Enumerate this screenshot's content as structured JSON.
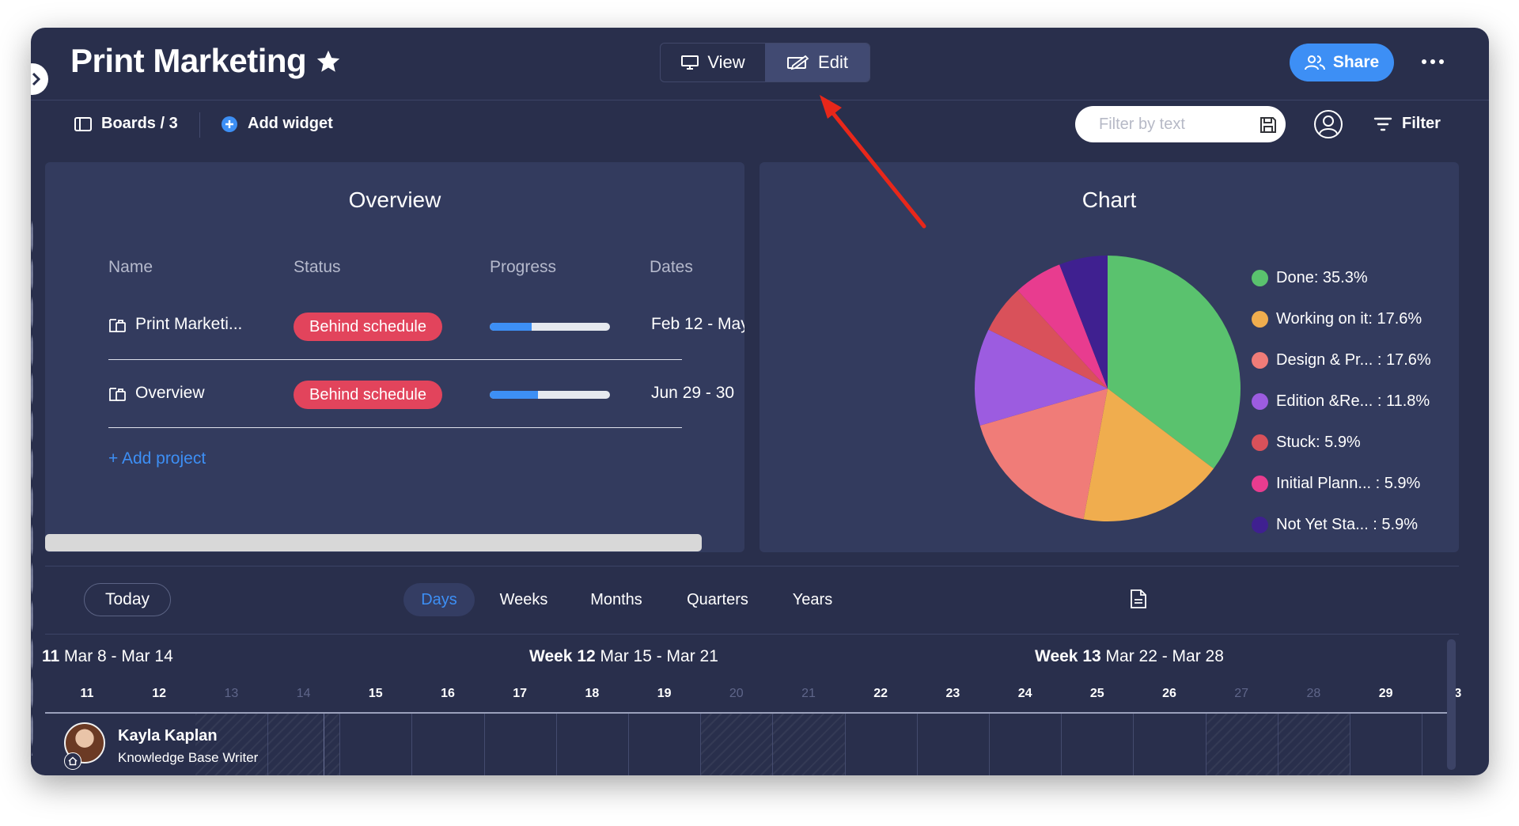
{
  "header": {
    "title": "Print Marketing",
    "view_label": "View",
    "edit_label": "Edit",
    "share_label": "Share"
  },
  "toolbar": {
    "boards_label": "Boards / 3",
    "add_widget_label": "Add widget",
    "filter_placeholder": "Filter by text",
    "filter_label": "Filter"
  },
  "overview": {
    "title": "Overview",
    "columns": [
      "Name",
      "Status",
      "Progress",
      "Dates"
    ],
    "rows": [
      {
        "name": "Print Marketi...",
        "status": "Behind schedule",
        "progress": 0.35,
        "dates": "Feb 12 - May"
      },
      {
        "name": "Overview",
        "status": "Behind schedule",
        "progress": 0.4,
        "dates": "Jun 29 - 30"
      }
    ],
    "add_project_label": "+ Add project"
  },
  "chart": {
    "title": "Chart"
  },
  "chart_data": {
    "type": "pie",
    "title": "Chart",
    "legend_position": "right",
    "slices": [
      {
        "label": "Done: 35.3%",
        "value": 35.3,
        "color": "#5ac26e"
      },
      {
        "label": "Working on it: 17.6%",
        "value": 17.6,
        "color": "#f0ad4e"
      },
      {
        "label": "Design & Pr... : 17.6%",
        "value": 17.6,
        "color": "#f07c78"
      },
      {
        "label": "Edition &Re... : 11.8%",
        "value": 11.8,
        "color": "#9c5ce0"
      },
      {
        "label": "Stuck: 5.9%",
        "value": 5.9,
        "color": "#d9515a"
      },
      {
        "label": "Initial Plann... : 5.9%",
        "value": 5.9,
        "color": "#e83c8f"
      },
      {
        "label": "Not Yet Sta... : 5.9%",
        "value": 5.9,
        "color": "#3f2090"
      }
    ]
  },
  "timeline": {
    "today_label": "Today",
    "scales": [
      "Days",
      "Weeks",
      "Months",
      "Quarters",
      "Years"
    ],
    "active_scale": "Days",
    "weeks": [
      {
        "prefix": "11",
        "range": "Mar 8 - Mar 14"
      },
      {
        "prefix": "Week 12",
        "range": "Mar 15 - Mar 21"
      },
      {
        "prefix": "Week 13",
        "range": "Mar 22 - Mar 28"
      }
    ],
    "days": [
      "11",
      "12",
      "13",
      "14",
      "15",
      "16",
      "17",
      "18",
      "19",
      "20",
      "21",
      "22",
      "23",
      "24",
      "25",
      "26",
      "27",
      "28",
      "29",
      "3"
    ],
    "weekend_days": [
      "13",
      "14",
      "20",
      "21",
      "27",
      "28"
    ],
    "person": {
      "name": "Kayla Kaplan",
      "role": "Knowledge Base Writer"
    }
  },
  "colors": {
    "background": "#292f4c",
    "panel": "#333b5e",
    "accent": "#3d8ff5",
    "status_behind": "#e2445c",
    "annotation_arrow": "#e8271a"
  }
}
